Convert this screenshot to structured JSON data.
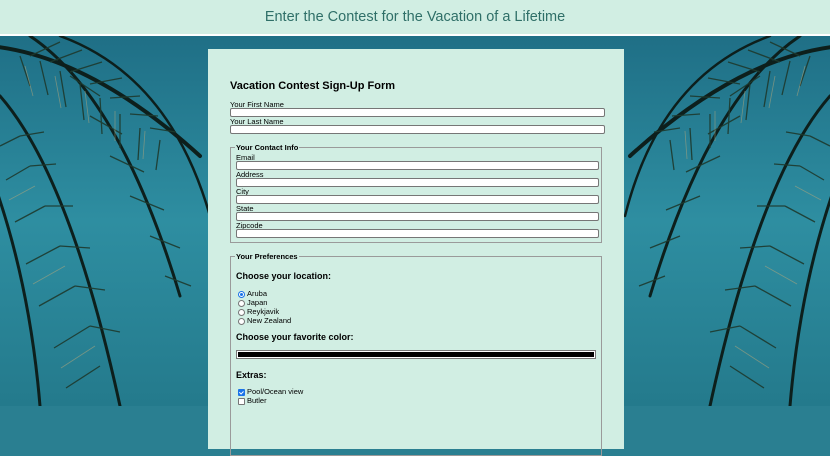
{
  "header": {
    "title": "Enter the Contest for the Vacation of a Lifetime"
  },
  "form": {
    "title": "Vacation Contest Sign-Up Form",
    "first_name_label": "Your First Name",
    "last_name_label": "Your Last Name",
    "contact": {
      "legend": "Your Contact Info",
      "email_label": "Email",
      "address_label": "Address",
      "city_label": "City",
      "state_label": "State",
      "zipcode_label": "Zipcode"
    },
    "preferences": {
      "legend": "Your Preferences",
      "location_heading": "Choose your location:",
      "locations": [
        {
          "label": "Aruba",
          "selected": true
        },
        {
          "label": "Japan",
          "selected": false
        },
        {
          "label": "Reykjavik",
          "selected": false
        },
        {
          "label": "New Zealand",
          "selected": false
        }
      ],
      "color_heading": "Choose your favorite color:",
      "color_value": "#000000",
      "extras_heading": "Extras:",
      "extras": [
        {
          "label": "Pool/Ocean view",
          "checked": true
        },
        {
          "label": "Butler",
          "checked": false
        }
      ]
    }
  },
  "colors": {
    "header_bg": "#d1eee3",
    "header_text": "#2f6f68",
    "card_bg": "#d1eee3",
    "sky": "#2a7f91",
    "accent": "#1a73e8"
  },
  "background": {
    "icon": "palm-fronds"
  }
}
